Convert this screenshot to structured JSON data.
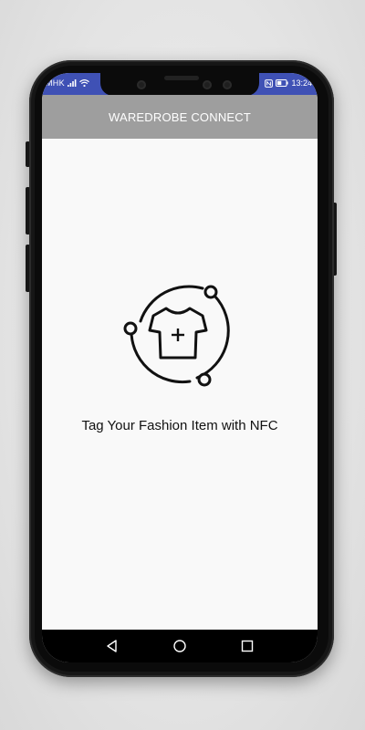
{
  "status_bar": {
    "carrier": "MHK",
    "time": "13:24",
    "background": "#3f51b5",
    "icons": [
      "signal-icon",
      "wifi-icon",
      "nfc-icon",
      "battery-icon"
    ]
  },
  "app_bar": {
    "title": "WAREDROBE CONNECT",
    "background": "#9e9e9e"
  },
  "main": {
    "illustration_icon": "tshirt-plus-orbit-icon",
    "headline": "Tag Your Fashion Item with NFC"
  },
  "nav_bar": {
    "buttons": [
      "back-icon",
      "home-icon",
      "recents-icon"
    ]
  }
}
